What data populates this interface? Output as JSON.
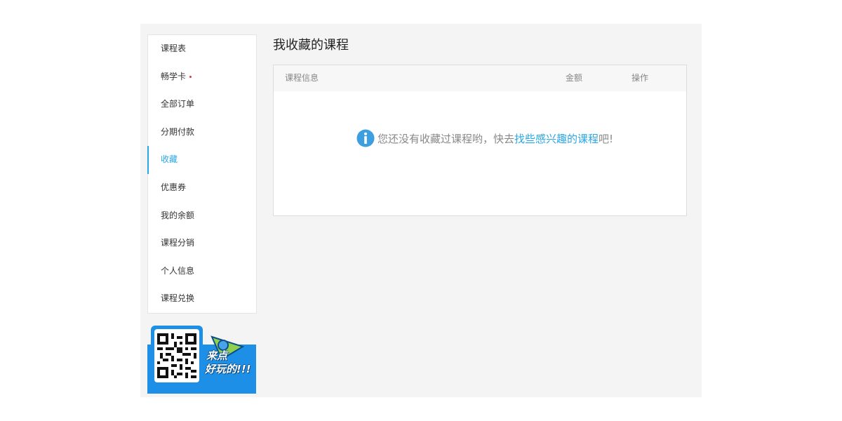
{
  "sidebar": {
    "items": [
      {
        "label": "课程表"
      },
      {
        "label": "畅学卡"
      },
      {
        "label": "全部订单"
      },
      {
        "label": "分期付款"
      },
      {
        "label": "收藏",
        "active": true
      },
      {
        "label": "优惠券"
      },
      {
        "label": "我的余额"
      },
      {
        "label": "课程分销"
      },
      {
        "label": "个人信息"
      },
      {
        "label": "课程兑换"
      }
    ],
    "promo": {
      "line1": "来点",
      "line2": "好玩的!!!"
    }
  },
  "main": {
    "title": "我收藏的课程",
    "table": {
      "headers": {
        "info": "课程信息",
        "amount": "金额",
        "op": "操作"
      },
      "empty": {
        "prefix": "您还没有收藏过课程哟，快去",
        "link": "找些感兴趣的课程",
        "suffix": "吧!"
      }
    }
  },
  "colors": {
    "accent": "#29a6e6",
    "badge": "#e0383e",
    "promo_bg": "#1d8fe6"
  }
}
